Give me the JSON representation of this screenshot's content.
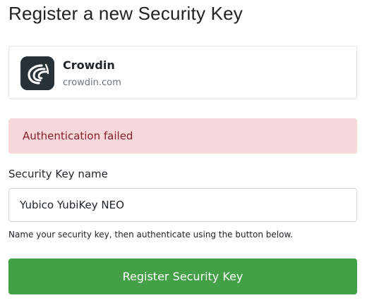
{
  "page": {
    "title": "Register a new Security Key"
  },
  "app": {
    "name": "Crowdin",
    "domain": "crowdin.com",
    "logo_icon": "crowdin-logo-icon"
  },
  "alert": {
    "message": "Authentication failed",
    "background_color": "#f8d7da",
    "text_color": "#842029"
  },
  "form": {
    "key_name_label": "Security Key name",
    "key_name_value": "Yubico YubiKey NEO",
    "help_text": "Name your security key, then authenticate using the button below.",
    "submit_label": "Register Security Key",
    "submit_color": "#43a047"
  }
}
